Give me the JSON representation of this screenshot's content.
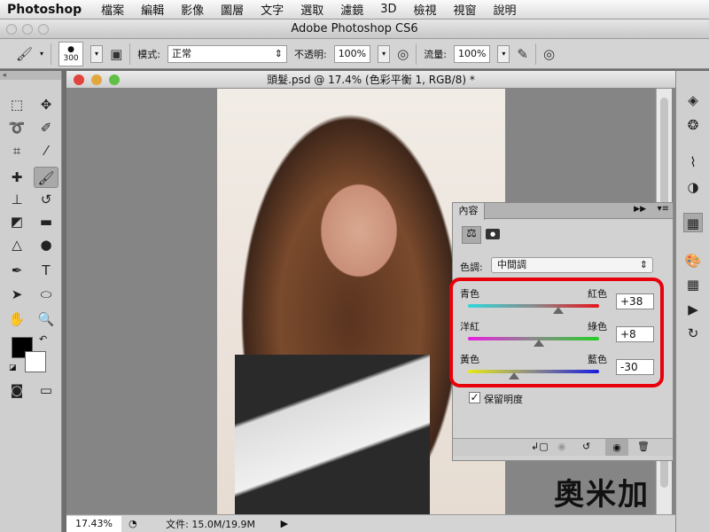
{
  "menubar": {
    "app": "Photoshop",
    "items": [
      "檔案",
      "編輯",
      "影像",
      "圖層",
      "文字",
      "選取",
      "濾鏡",
      "3D",
      "檢視",
      "視窗",
      "說明"
    ]
  },
  "app_title": "Adobe Photoshop CS6",
  "options": {
    "brush_size": "300",
    "mode_label": "模式:",
    "mode_value": "正常",
    "opacity_label": "不透明:",
    "opacity_value": "100%",
    "flow_label": "流量:",
    "flow_value": "100%"
  },
  "document": {
    "title": "頭髮.psd @ 17.4% (色彩平衡 1, RGB/8) *",
    "zoom": "17.43%",
    "file_info": "文件: 15.0M/19.9M"
  },
  "properties": {
    "tab": "內容",
    "tone_label": "色調:",
    "tone_value": "中間調",
    "sliders": [
      {
        "left": "青色",
        "right": "紅色",
        "value": "+38",
        "pos": 0.69
      },
      {
        "left": "洋紅",
        "right": "綠色",
        "value": "+8",
        "pos": 0.54
      },
      {
        "left": "黃色",
        "right": "藍色",
        "value": "-30",
        "pos": 0.35
      }
    ],
    "preserve_luminosity": "保留明度",
    "preserve_checked": true
  },
  "watermark": "奧米加"
}
